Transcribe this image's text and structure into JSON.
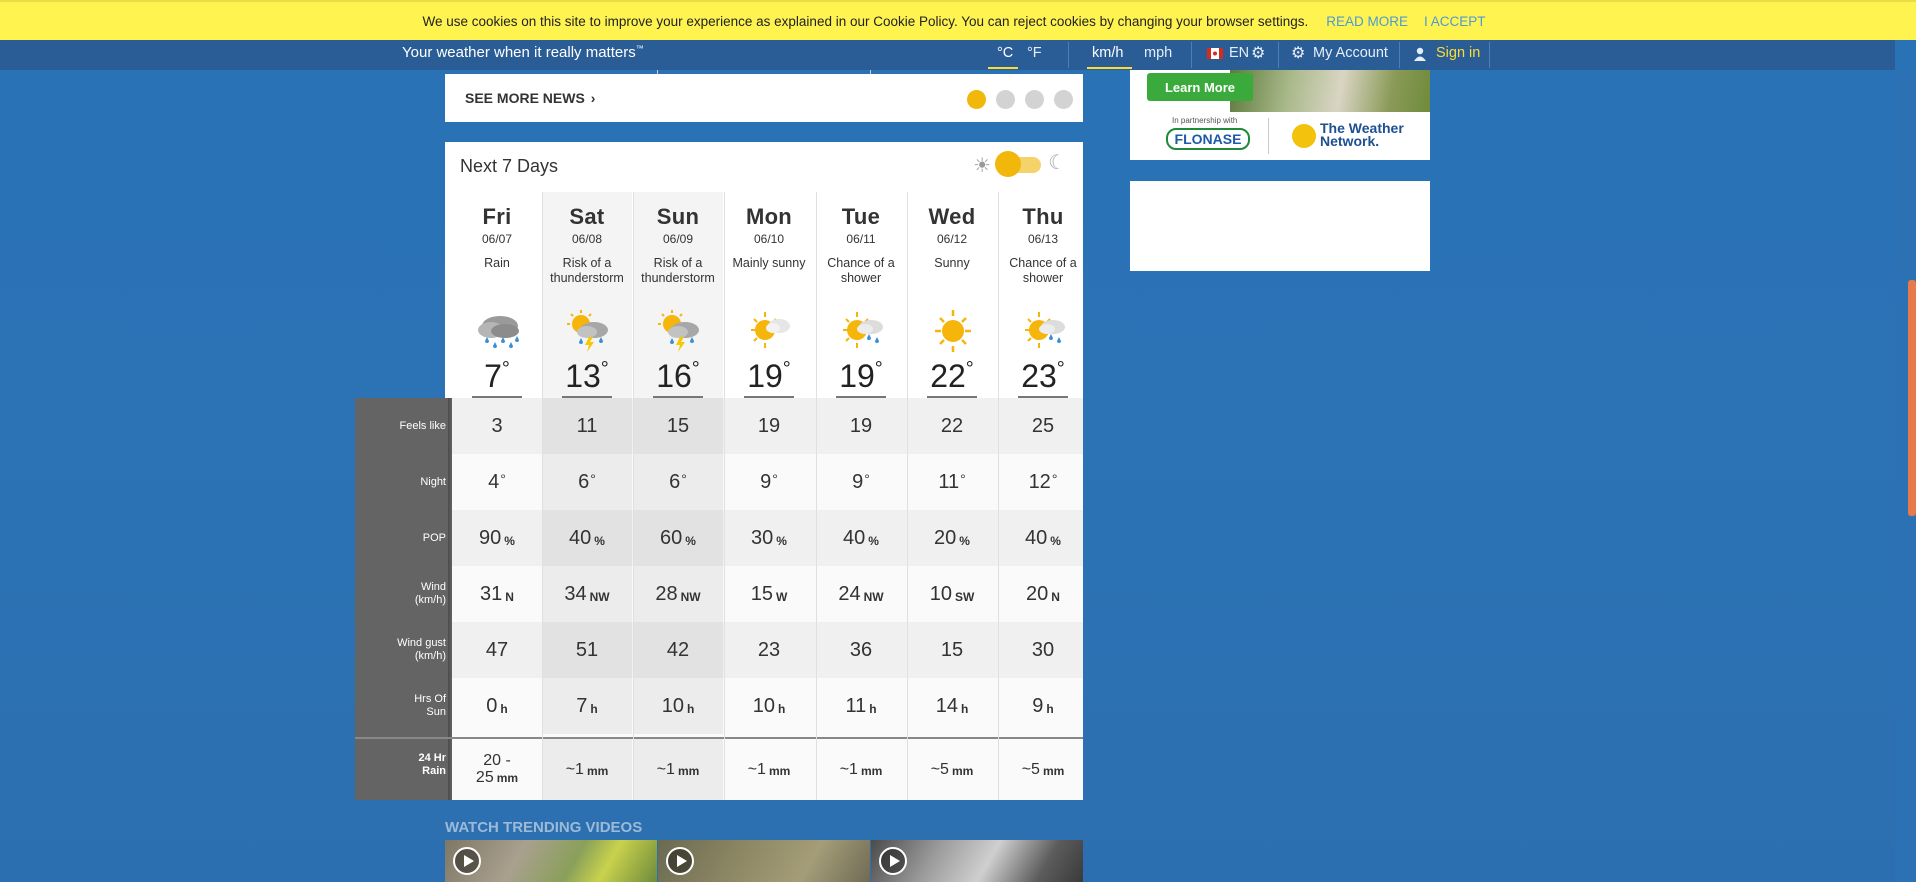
{
  "cookie": {
    "message": "We use cookies on this site to improve your experience as explained in our Cookie Policy. You can reject cookies by changing your browser settings.",
    "read_more": "READ MORE",
    "accept": "I ACCEPT"
  },
  "nav": {
    "tagline": "Your weather when it really matters",
    "tagline_tm": "™",
    "unit_c": "°C",
    "unit_f": "°F",
    "unit_kmh": "km/h",
    "unit_mph": "mph",
    "lang": "EN",
    "my_account": "My Account",
    "sign_in": "Sign in"
  },
  "news": {
    "see_more": "SEE MORE NEWS",
    "chevron": "›"
  },
  "ad": {
    "learn_more": "Learn More",
    "partnership": "In partnership with",
    "flonase": "FLONASE",
    "twn_line1": "The Weather",
    "twn_line2": "Network."
  },
  "forecast": {
    "title": "Next 7 Days",
    "sun_symbol": "☀",
    "moon_symbol": "☾",
    "days": [
      {
        "name": "Fri",
        "date": "06/07",
        "cond": "Rain",
        "icon": "rain-icon",
        "temp": "7",
        "feels": "3",
        "night": "4",
        "pop": "90",
        "wind": "31",
        "wind_dir": "N",
        "gust": "47",
        "sun": "0",
        "rain_top": "20 -",
        "rain": "25"
      },
      {
        "name": "Sat",
        "date": "06/08",
        "cond": "Risk of a thunderstorm",
        "icon": "thunderstorm-icon",
        "temp": "13",
        "feels": "11",
        "night": "6",
        "pop": "40",
        "wind": "34",
        "wind_dir": "NW",
        "gust": "51",
        "sun": "7",
        "rain_top": "",
        "rain": "~1"
      },
      {
        "name": "Sun",
        "date": "06/09",
        "cond": "Risk of a thunderstorm",
        "icon": "thunderstorm-icon",
        "temp": "16",
        "feels": "15",
        "night": "6",
        "pop": "60",
        "wind": "28",
        "wind_dir": "NW",
        "gust": "42",
        "sun": "10",
        "rain_top": "",
        "rain": "~1"
      },
      {
        "name": "Mon",
        "date": "06/10",
        "cond": "Mainly sunny",
        "icon": "mainly-sunny-icon",
        "temp": "19",
        "feels": "19",
        "night": "9",
        "pop": "30",
        "wind": "15",
        "wind_dir": "W",
        "gust": "23",
        "sun": "10",
        "rain_top": "",
        "rain": "~1"
      },
      {
        "name": "Tue",
        "date": "06/11",
        "cond": "Chance of a shower",
        "icon": "sun-shower-icon",
        "temp": "19",
        "feels": "19",
        "night": "9",
        "pop": "40",
        "wind": "24",
        "wind_dir": "NW",
        "gust": "36",
        "sun": "11",
        "rain_top": "",
        "rain": "~1"
      },
      {
        "name": "Wed",
        "date": "06/12",
        "cond": "Sunny",
        "icon": "sunny-icon",
        "temp": "22",
        "feels": "22",
        "night": "11",
        "pop": "20",
        "wind": "10",
        "wind_dir": "SW",
        "gust": "15",
        "sun": "14",
        "rain_top": "",
        "rain": "~5"
      },
      {
        "name": "Thu",
        "date": "06/13",
        "cond": "Chance of a shower",
        "icon": "sun-shower-icon",
        "temp": "23",
        "feels": "25",
        "night": "12",
        "pop": "40",
        "wind": "20",
        "wind_dir": "N",
        "gust": "30",
        "sun": "9",
        "rain_top": "",
        "rain": "~5"
      }
    ],
    "labels": {
      "feels": "Feels like",
      "night": "Night",
      "pop": "POP",
      "wind_1": "Wind",
      "wind_2": "(km/h)",
      "gust_1": "Wind gust",
      "gust_2": "(km/h)",
      "sun_1": "Hrs Of",
      "sun_2": "Sun",
      "rain_1": "24 Hr",
      "rain_2": "Rain"
    },
    "units": {
      "deg": "°",
      "pct": "%",
      "hours": "h",
      "mm": "mm"
    }
  },
  "videos": {
    "title": "WATCH TRENDING VIDEOS"
  }
}
